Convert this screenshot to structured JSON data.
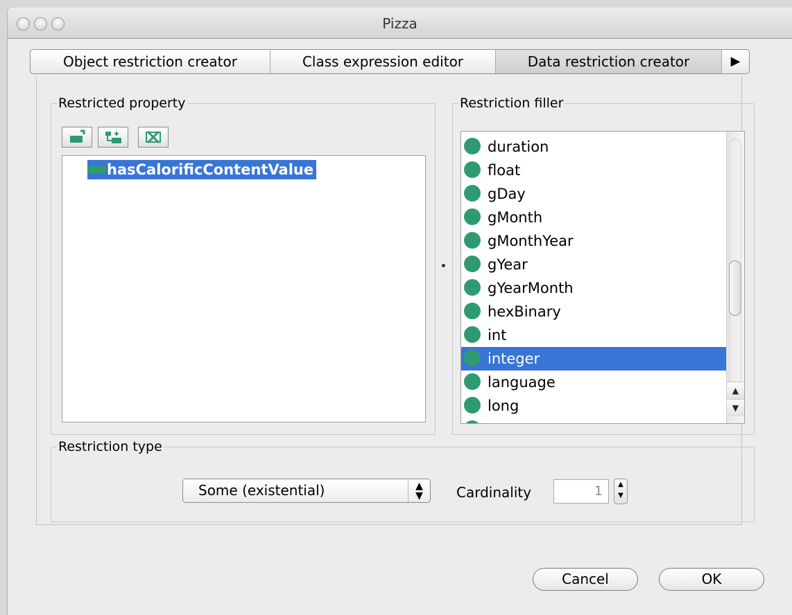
{
  "window": {
    "title": "Pizza"
  },
  "tabs": [
    {
      "label": "Object restriction creator"
    },
    {
      "label": "Class expression editor"
    },
    {
      "label": "Data restriction creator",
      "active": true
    },
    {
      "label": "▶"
    }
  ],
  "restricted_property": {
    "legend": "Restricted property",
    "toolbar": [
      "add-subproperty-icon",
      "add-sibling-property-icon",
      "delete-property-icon"
    ],
    "selected_item": "hasCalorificContentValue"
  },
  "restriction_filler": {
    "legend": "Restriction filler",
    "items": [
      {
        "label": "duration"
      },
      {
        "label": "float"
      },
      {
        "label": "gDay"
      },
      {
        "label": "gMonth"
      },
      {
        "label": "gMonthYear"
      },
      {
        "label": "gYear"
      },
      {
        "label": "gYearMonth"
      },
      {
        "label": "hexBinary"
      },
      {
        "label": "int"
      },
      {
        "label": "integer",
        "selected": true
      },
      {
        "label": "language"
      },
      {
        "label": "long"
      }
    ]
  },
  "restriction_type": {
    "legend": "Restriction type",
    "selected": "Some (existential)",
    "cardinality_label": "Cardinality",
    "cardinality_value": "1"
  },
  "buttons": {
    "cancel": "Cancel",
    "ok": "OK"
  },
  "colors": {
    "selection": "#3875d7",
    "datatype_icon": "#2f9a72"
  }
}
